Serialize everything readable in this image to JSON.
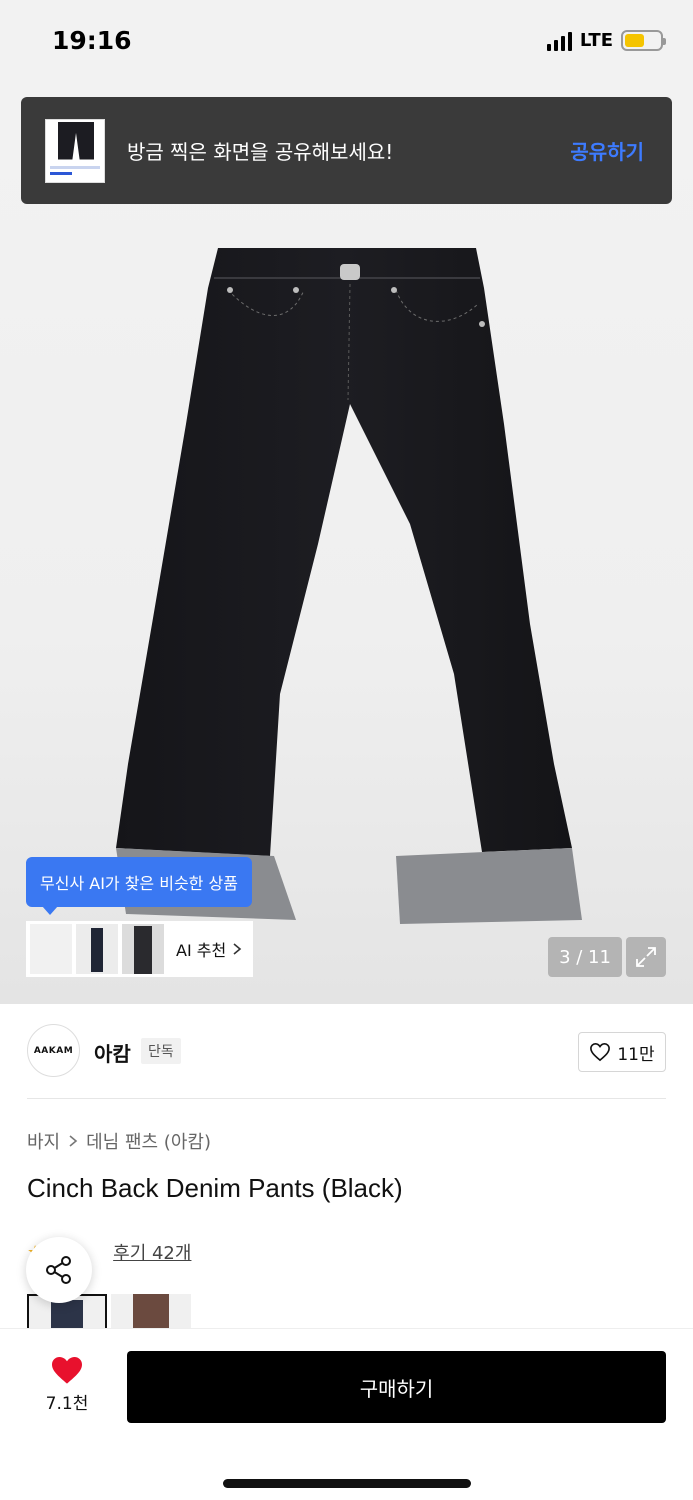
{
  "status": {
    "time": "19:16",
    "network": "LTE",
    "battery_level": 0.55,
    "battery_color": "#f5c400"
  },
  "share_toast": {
    "message": "방금 찍은 화면을 공유해보세요!",
    "action": "공유하기",
    "action_color": "#3d7bff"
  },
  "gallery": {
    "ai_tooltip": "무신사 AI가 찾은 비슷한 상품",
    "ai_recommend_label": "AI 추천",
    "counter": "3 / 11",
    "expand_icon": "expand-icon"
  },
  "brand": {
    "logo_text": "AAKAM",
    "name": "아캄",
    "badge": "단독"
  },
  "like": {
    "count": "11만",
    "icon": "heart-outline-icon"
  },
  "breadcrumb": {
    "category": "바지",
    "separator": ">",
    "subcategory": "데님 팬츠 (아캄)"
  },
  "product": {
    "title": "Cinch Back Denim Pants (Black)"
  },
  "reviews": {
    "link": "후기 42개"
  },
  "bottom_bar": {
    "like_total": "7.1천",
    "buy_label": "구매하기",
    "heart_color": "#e8112d"
  },
  "colors": {
    "ai_blue": "#3a78f2",
    "toast_bg": "#3a3a3a",
    "buy_bg": "#000000"
  }
}
